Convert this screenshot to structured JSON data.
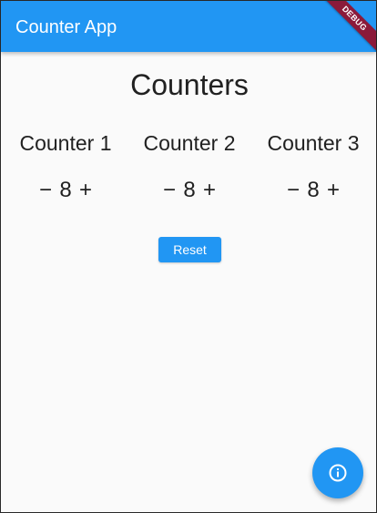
{
  "app_bar": {
    "title": "Counter App",
    "debug_banner": "DEBUG"
  },
  "page": {
    "title": "Counters"
  },
  "counters": [
    {
      "label": "Counter 1",
      "decrement": "−",
      "value": "8",
      "increment": "+"
    },
    {
      "label": "Counter 2",
      "decrement": "−",
      "value": "8",
      "increment": "+"
    },
    {
      "label": "Counter 3",
      "decrement": "−",
      "value": "8",
      "increment": "+"
    }
  ],
  "reset_button": {
    "label": "Reset"
  },
  "fab": {
    "icon": "info-icon"
  },
  "colors": {
    "primary": "#2196f3",
    "background": "#fafafa",
    "debug_banner": "#8b1a3a"
  }
}
